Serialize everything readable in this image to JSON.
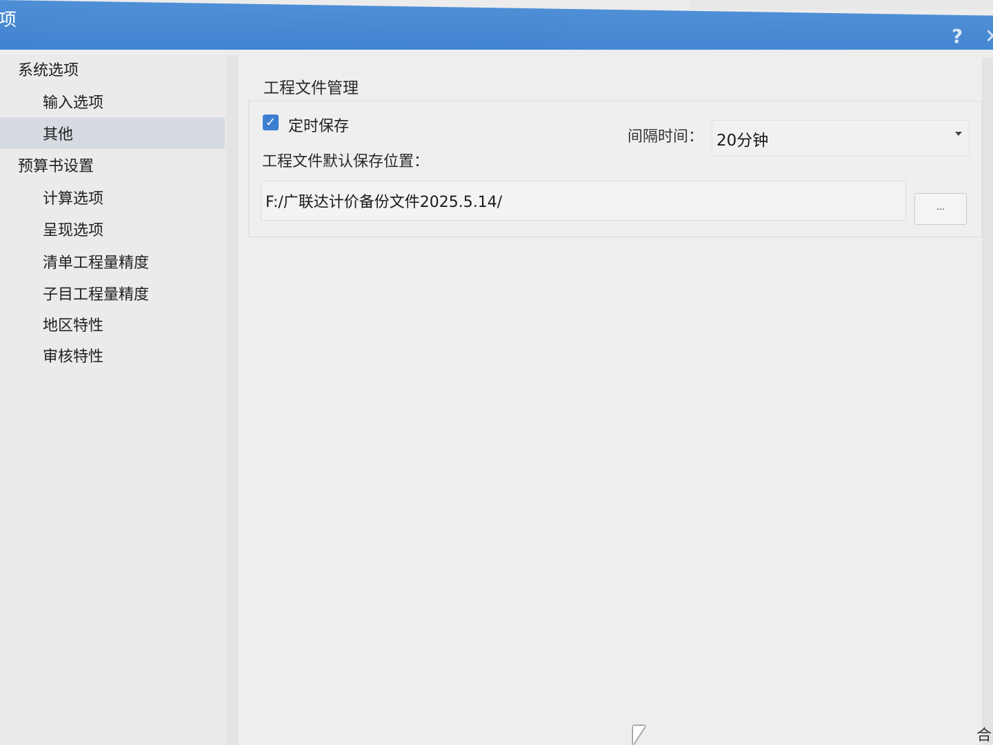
{
  "window": {
    "title": "项",
    "help_glyph": "?",
    "close_glyph": "✕"
  },
  "sidebar": {
    "items": [
      {
        "label": "系统选项",
        "level": 0
      },
      {
        "label": "输入选项",
        "level": 1
      },
      {
        "label": "其他",
        "level": 1,
        "selected": true
      },
      {
        "label": "预算书设置",
        "level": 0
      },
      {
        "label": "计算选项",
        "level": 1
      },
      {
        "label": "呈现选项",
        "level": 1
      },
      {
        "label": "清单工程量精度",
        "level": 1
      },
      {
        "label": "子目工程量精度",
        "level": 1
      },
      {
        "label": "地区特性",
        "level": 1
      },
      {
        "label": "审核特性",
        "level": 1
      }
    ]
  },
  "content": {
    "section_title": "工程文件管理",
    "autosave_label": "定时保存",
    "autosave_checked": true,
    "interval_label": "间隔时间：",
    "interval_value": "20分钟",
    "path_label": "工程文件默认保存位置：",
    "path_value": "F:/广联达计价备份文件2025.5.14/",
    "browse_label": "..."
  },
  "footer": {
    "partial_text": "合"
  },
  "icons": {
    "checkbox": "check-icon",
    "dropdown": "chevron-down-icon",
    "help": "help-icon",
    "close": "close-icon"
  },
  "colors": {
    "titlebar": "#3f82cf",
    "checkbox": "#3d7fd0",
    "selected_row": "#d6dbe2"
  }
}
